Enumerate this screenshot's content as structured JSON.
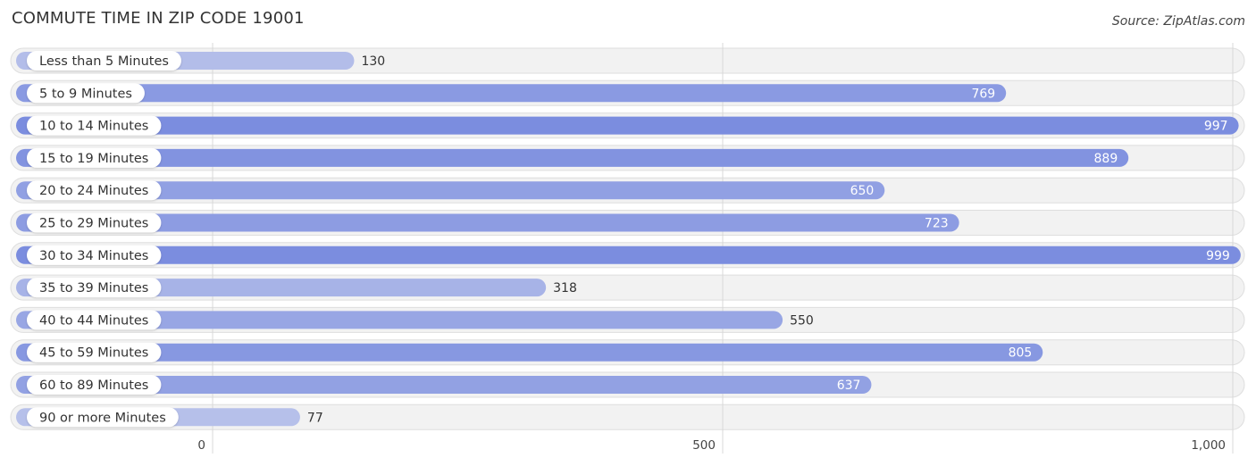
{
  "chart_data": {
    "type": "bar",
    "orientation": "horizontal",
    "title": "COMMUTE TIME IN ZIP CODE 19001",
    "source": "Source: ZipAtlas.com",
    "categories": [
      "Less than 5 Minutes",
      "5 to 9 Minutes",
      "10 to 14 Minutes",
      "15 to 19 Minutes",
      "20 to 24 Minutes",
      "25 to 29 Minutes",
      "30 to 34 Minutes",
      "35 to 39 Minutes",
      "40 to 44 Minutes",
      "45 to 59 Minutes",
      "60 to 89 Minutes",
      "90 or more Minutes"
    ],
    "values": [
      130,
      769,
      997,
      889,
      650,
      723,
      999,
      318,
      550,
      805,
      637,
      77
    ],
    "value_labels": [
      "130",
      "769",
      "997",
      "889",
      "650",
      "723",
      "999",
      "318",
      "550",
      "805",
      "637",
      "77"
    ],
    "xlim": [
      0,
      1000
    ],
    "xticks": [
      0,
      500,
      1000
    ],
    "xtick_labels": [
      "0",
      "500",
      "1,000"
    ],
    "xlabel": "",
    "ylabel": "",
    "grid": true,
    "colors": {
      "bar_light": "#b6c0ea",
      "bar_dark": "#7b8ddf",
      "track": "#f2f2f2",
      "track_border": "#dedede",
      "grid": "#d8d8d8"
    }
  }
}
